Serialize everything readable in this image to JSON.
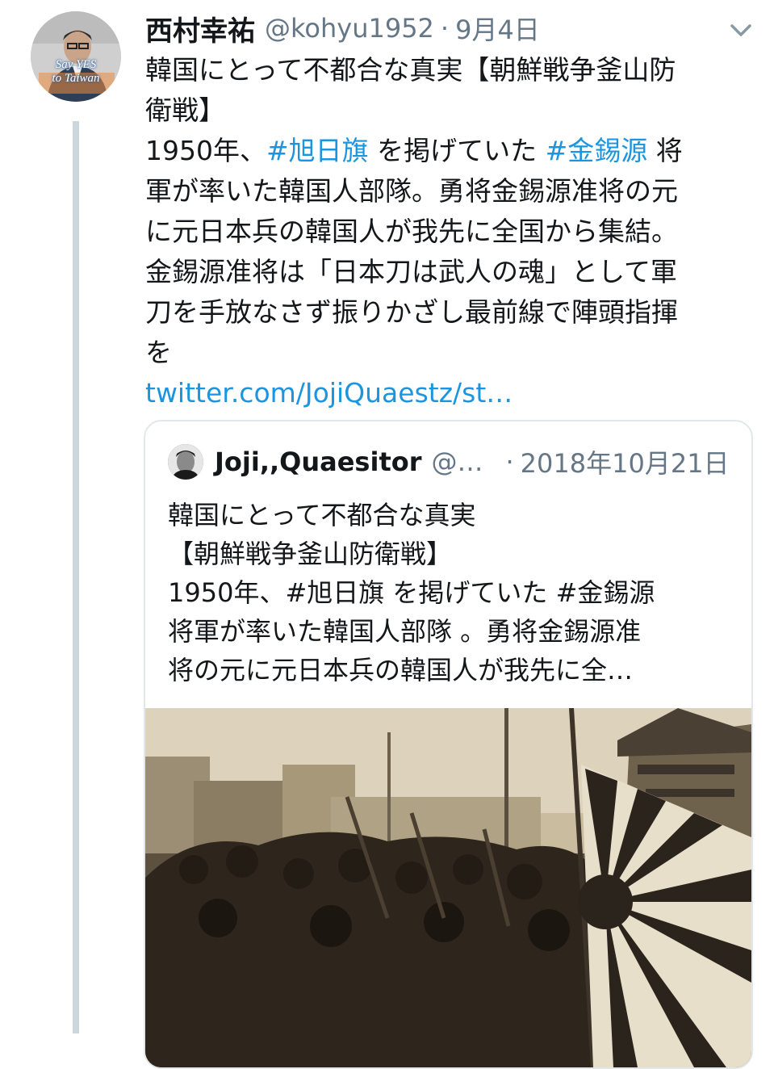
{
  "tweet": {
    "author_name": "西村幸祐",
    "author_handle": "@kohyu1952",
    "separator": "·",
    "date": "9月4日",
    "avatar_text": [
      "Say YES",
      "to Taiwan"
    ],
    "text_part1": "韓国にとって不都合な真実【朝鮮戦争釜山防\n衛戦】\n1950年、",
    "hashtag1": "#旭日旗",
    "text_part2": " を掲げていた ",
    "hashtag2": "#金錫源",
    "text_part3": " 将\n軍が率いた韓国人部隊。勇将金錫源准将の元\nに元日本兵の韓国人が我先に全国から集結。\n金錫源准将は「日本刀は武人の魂」として軍\n刀を手放なさず振りかざし最前線で陣頭指揮\nを",
    "link": "twitter.com/JojiQuaestz/st…"
  },
  "quote": {
    "author_name": "Joji,,Quaesitor",
    "author_handle": "@…",
    "separator": "·",
    "date": "2018年10月21日",
    "text": "韓国にとって不都合な真実\n【朝鮮戦争釜山防衛戦】\n1950年、#旭日旗 を掲げていた #金錫源\n将軍が率いた韓国人部隊 。勇将金錫源准\n将の元に元日本兵の韓国人が我先に全…"
  },
  "icons": {
    "menu": "chevron-down-icon"
  },
  "colors": {
    "link": "#1b95e0",
    "secondary_text": "#657786",
    "border": "#e1e8ed",
    "thread_line": "#ccd6dd"
  }
}
